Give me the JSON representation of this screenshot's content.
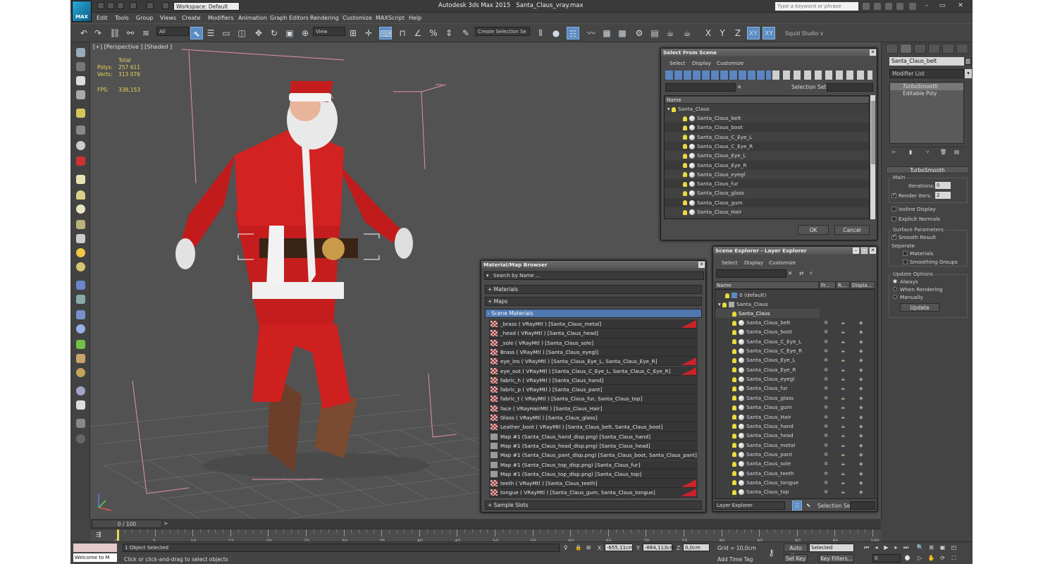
{
  "titlebar": {
    "logo": "MAX",
    "workspace": "Workspace: Default",
    "app_title": "Autodesk 3ds Max  2015",
    "file": "Santa_Claus_vray.max",
    "search_placeholder": "Type a keyword or phrase"
  },
  "menu": [
    "Edit",
    "Tools",
    "Group",
    "Views",
    "Create",
    "Modifiers",
    "Animation",
    "Graph Editors",
    "Rendering",
    "Customize",
    "MAXScript",
    "Help"
  ],
  "toolbar": {
    "filter": "All",
    "refcoord": "View",
    "named_sel": "Create Selection Se",
    "axis": [
      "X",
      "Y",
      "Z",
      "XY",
      "XY"
    ],
    "squid": "Squid Studio v"
  },
  "viewport": {
    "label": "[+] [Perspective ] [Shaded ]",
    "stats": {
      "header": "Total",
      "polys_label": "Polys:",
      "polys": "257 611",
      "verts_label": "Verts:",
      "verts": "313 076",
      "fps_label": "FPS:",
      "fps": "338,153"
    }
  },
  "select_from_scene": {
    "title": "Select From Scene",
    "menu": [
      "Select",
      "Display",
      "Customize"
    ],
    "selection_set_label": "Selection Set:",
    "column": "Name",
    "root": "Santa_Claus",
    "items": [
      "Santa_Claus_belt",
      "Santa_Claus_boot",
      "Santa_Claus_C_Eye_L",
      "Santa_Claus_C_Eye_R",
      "Santa_Claus_Eye_L",
      "Santa_Claus_Eye_R",
      "Santa_Claus_eyegl",
      "Santa_Claus_fur",
      "Santa_Claus_glass",
      "Santa_Claus_gum",
      "Santa_Claus_Hair"
    ],
    "ok": "OK",
    "cancel": "Cancel"
  },
  "material_browser": {
    "title": "Material/Map Browser",
    "search": "Search by Name ...",
    "sections": {
      "materials": "+ Materials",
      "maps": "+ Maps",
      "scene": "- Scene Materials",
      "slots": "+ Sample Slots"
    },
    "rows": [
      {
        "text": "_brass  ( VRayMtl ) [Santa_Claus_metal]",
        "kind": "mat",
        "flag": true
      },
      {
        "text": "_head  ( VRayMtl ) [Santa_Claus_head]",
        "kind": "mat",
        "flag": false
      },
      {
        "text": "_sole  ( VRayMtl ) [Santa_Claus_sole]",
        "kind": "mat",
        "flag": false
      },
      {
        "text": "Brass  ( VRayMtl ) [Santa_Claus_eyegl]",
        "kind": "mat",
        "flag": false
      },
      {
        "text": "eye_ins  ( VRayMtl ) [Santa_Claus_Eye_L, Santa_Claus_Eye_R]",
        "kind": "mat",
        "flag": true
      },
      {
        "text": "eye_out  ( VRayMtl ) [Santa_Claus_C_Eye_L, Santa_Claus_C_Eye_R]",
        "kind": "mat",
        "flag": true
      },
      {
        "text": "fabric_h  ( VRayMtl ) [Santa_Claus_hand]",
        "kind": "mat",
        "flag": false
      },
      {
        "text": "fabric_p  ( VRayMtl ) [Santa_Claus_pant]",
        "kind": "mat",
        "flag": false
      },
      {
        "text": "fabric_t  ( VRayMtl ) [Santa_Claus_fur, Santa_Claus_top]",
        "kind": "mat",
        "flag": false
      },
      {
        "text": "face  ( VRayHairMtl ) [Santa_Claus_Hair]",
        "kind": "mat",
        "flag": false
      },
      {
        "text": "Glass  ( VRayMtl ) [Santa_Claus_glass]",
        "kind": "mat",
        "flag": false
      },
      {
        "text": "Leather_boot  ( VRayMtl ) [Santa_Claus_belt, Santa_Claus_boot]",
        "kind": "mat",
        "flag": false
      },
      {
        "text": "Map #1 (Santa_Claus_hand_disp.png) [Santa_Claus_hand]",
        "kind": "map",
        "flag": false
      },
      {
        "text": "Map #1 (Santa_Claus_head_disp.png) [Santa_Claus_head]",
        "kind": "map",
        "flag": false
      },
      {
        "text": "Map #1 (Santa_Claus_pant_disp.png) [Santa_Claus_boot, Santa_Claus_pant]",
        "kind": "map",
        "flag": false
      },
      {
        "text": "Map #1 (Santa_Claus_top_disp.png) [Santa_Claus_fur]",
        "kind": "map",
        "flag": false
      },
      {
        "text": "Map #1 (Santa_Claus_top_disp.png) [Santa_Claus_top]",
        "kind": "map",
        "flag": false
      },
      {
        "text": "teeth  ( VRayMtl ) [Santa_Claus_teeth]",
        "kind": "mat",
        "flag": true
      },
      {
        "text": "tongue  ( VRayMtl ) [Santa_Claus_gum, Santa_Claus_tongue]",
        "kind": "mat",
        "flag": true
      }
    ]
  },
  "scene_explorer": {
    "title": "Scene Explorer - Layer Explorer",
    "menu": [
      "Select",
      "Display",
      "Customize"
    ],
    "cols": [
      "Name",
      "Fr...",
      "R...",
      "Displa..."
    ],
    "layer0": "0 (default)",
    "layer1": "Santa_Claus",
    "root": "Santa_Claus",
    "items": [
      "Santa_Claus_belt",
      "Santa_Claus_boot",
      "Santa_Claus_C_Eye_L",
      "Santa_Claus_C_Eye_R",
      "Santa_Claus_Eye_L",
      "Santa_Claus_Eye_R",
      "Santa_Claus_eyegl",
      "Santa_Claus_fur",
      "Santa_Claus_glass",
      "Santa_Claus_gum",
      "Santa_Claus_Hair",
      "Santa_Claus_hand",
      "Santa_Claus_head",
      "Santa_Claus_metal",
      "Santa_Claus_pant",
      "Santa_Claus_sole",
      "Santa_Claus_teeth",
      "Santa_Claus_tongue",
      "Santa_Claus_top"
    ],
    "footer_dd": "Layer Explorer",
    "selection_set": "Selection Set:"
  },
  "command_panel": {
    "object_name": "Santa_Claus_belt",
    "modifier_list": "Modifier List",
    "stack": [
      "TurboSmooth",
      "Editable Poly"
    ],
    "rollout": "TurboSmooth",
    "main": "Main",
    "iterations_label": "Iterations:",
    "iterations": "0",
    "render_iters_label": "Render Iters:",
    "render_iters": "2",
    "isoline": "Isoline Display",
    "explicit": "Explicit Normals",
    "surface": "Surface Parameters",
    "smooth_result": "Smooth Result",
    "separate": "Separate",
    "materials": "Materials",
    "smoothing_groups": "Smoothing Groups",
    "update_options": "Update Options",
    "always": "Always",
    "when_rendering": "When Rendering",
    "manually": "Manually",
    "update_btn": "Update"
  },
  "timeline": {
    "slider": "0 / 100",
    "ticks": [
      "0",
      "5",
      "10",
      "15",
      "20",
      "25",
      "30",
      "35",
      "40",
      "45",
      "50",
      "55",
      "60",
      "65",
      "70",
      "75",
      "80",
      "85",
      "90",
      "95",
      "100"
    ]
  },
  "status": {
    "maxscript": "Welcome to M",
    "selected": "1 Object Selected",
    "prompt": "Click or click-and-drag to select objects",
    "x_label": "X:",
    "x": "-655,11cm",
    "y_label": "Y:",
    "y": "-864,113cm",
    "z_label": "Z:",
    "z": "0,0cm",
    "grid": "Grid = 10,0cm",
    "add_time_tag": "Add Time Tag",
    "auto_key": "Auto Key",
    "selected_dd": "Selected",
    "set_key": "Set Key",
    "key_filters": "Key Filters...",
    "frame": "0"
  }
}
